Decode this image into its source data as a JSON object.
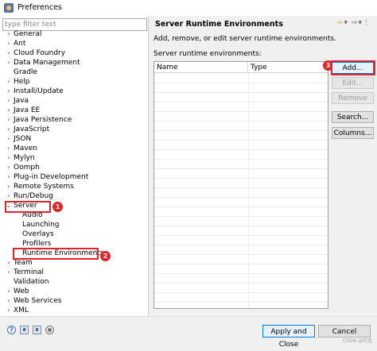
{
  "window": {
    "title": "Preferences"
  },
  "filter": {
    "placeholder": "type filter text"
  },
  "tree": {
    "items": [
      {
        "label": "General",
        "expanded": false
      },
      {
        "label": "Ant",
        "expanded": false
      },
      {
        "label": "Cloud Foundry",
        "expanded": false
      },
      {
        "label": "Data Management",
        "expanded": false
      },
      {
        "label": "Gradle",
        "expanded": null
      },
      {
        "label": "Help",
        "expanded": false
      },
      {
        "label": "Install/Update",
        "expanded": false
      },
      {
        "label": "Java",
        "expanded": false
      },
      {
        "label": "Java EE",
        "expanded": false
      },
      {
        "label": "Java Persistence",
        "expanded": false
      },
      {
        "label": "JavaScript",
        "expanded": false
      },
      {
        "label": "JSON",
        "expanded": false
      },
      {
        "label": "Maven",
        "expanded": false
      },
      {
        "label": "Mylyn",
        "expanded": false
      },
      {
        "label": "Oomph",
        "expanded": false
      },
      {
        "label": "Plug-in Development",
        "expanded": false
      },
      {
        "label": "Remote Systems",
        "expanded": false
      },
      {
        "label": "Run/Debug",
        "expanded": false
      },
      {
        "label": "Server",
        "expanded": true
      },
      {
        "label": "Audio",
        "child": true
      },
      {
        "label": "Launching",
        "child": true
      },
      {
        "label": "Overlays",
        "child": true
      },
      {
        "label": "Profilers",
        "child": true
      },
      {
        "label": "Runtime Environments",
        "child": true,
        "selected": true
      },
      {
        "label": "Team",
        "expanded": false
      },
      {
        "label": "Terminal",
        "expanded": false
      },
      {
        "label": "Validation",
        "expanded": null
      },
      {
        "label": "Web",
        "expanded": false
      },
      {
        "label": "Web Services",
        "expanded": false
      },
      {
        "label": "XML",
        "expanded": false
      }
    ]
  },
  "annotations": {
    "badge1": "1",
    "badge2": "2",
    "badge3": "3",
    "color": "#e0262b"
  },
  "page": {
    "title": "Server Runtime Environments",
    "description": "Add, remove, or edit server runtime environments.",
    "list_label": "Server runtime environments:",
    "columns": [
      "Name",
      "Type"
    ]
  },
  "buttons": {
    "add": "Add...",
    "edit": "Edit...",
    "remove": "Remove",
    "search": "Search...",
    "columns": "Columns..."
  },
  "footer": {
    "apply_close": "Apply and Close",
    "cancel": "Cancel",
    "watermark": "CSDN @打北"
  }
}
